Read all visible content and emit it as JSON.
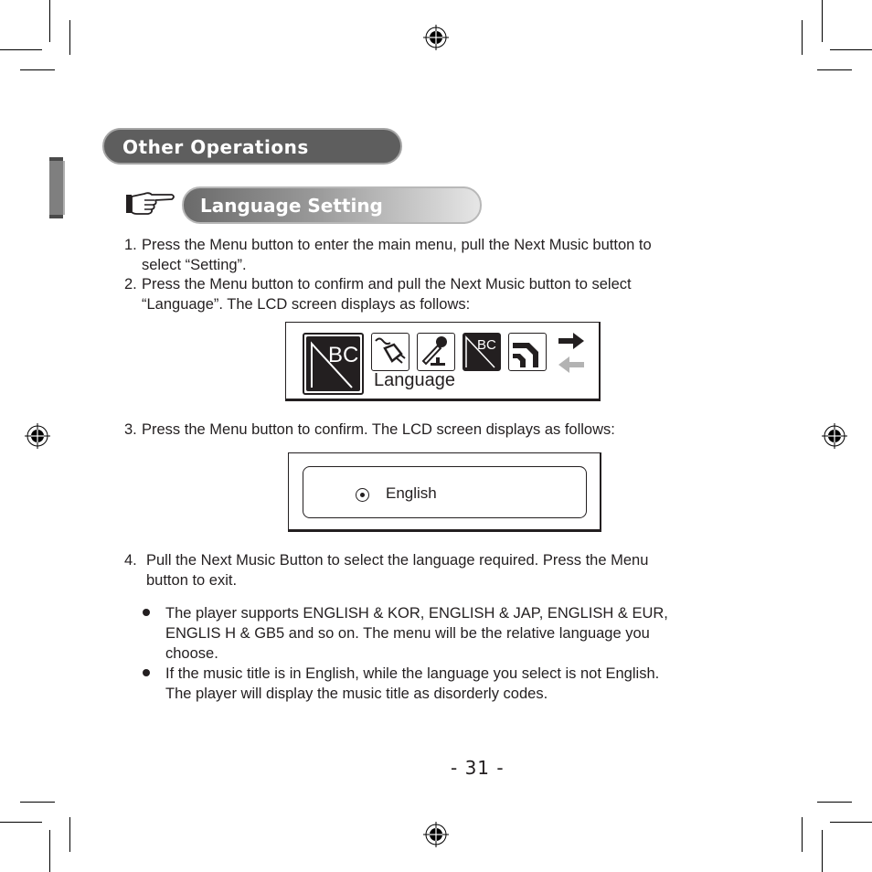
{
  "section_title": "Other Operations",
  "subsection_title": "Language Setting",
  "steps": [
    {
      "num": "1.",
      "lines": [
        "Press the Menu button to enter the main menu, pull the Next Music button to",
        "select “Setting”."
      ]
    },
    {
      "num": "2.",
      "lines": [
        "Press the Menu button to confirm and pull the Next Music button to select",
        "“Language”. The LCD screen displays as follows:"
      ]
    },
    {
      "num": "3.",
      "lines": [
        "Press the Menu button to confirm. The LCD screen displays as follows:"
      ]
    },
    {
      "num": "4.",
      "lines": [
        "Pull the Next Music Button to select the language required. Press the Menu",
        "button to exit."
      ]
    }
  ],
  "lcd_menu": {
    "icons": [
      "language-abc-icon",
      "power-plug-icon",
      "microphone-icon",
      "language-abc-icon",
      "exit-return-icon"
    ],
    "label": "Language",
    "nav": [
      "arrow-right-icon",
      "arrow-left-icon"
    ]
  },
  "lcd_language": {
    "option": "English",
    "selected": true
  },
  "notes": [
    [
      "The player supports ENGLISH & KOR, ENGLISH & JAP, ENGLISH & EUR,",
      "ENGLIS H & GB5 and so on. The menu will be the relative language you",
      "choose."
    ],
    [
      "If the music title is in English, while the language you select is not English.",
      "The player will display the music title as disorderly codes."
    ]
  ],
  "page_number": "- 31 -"
}
